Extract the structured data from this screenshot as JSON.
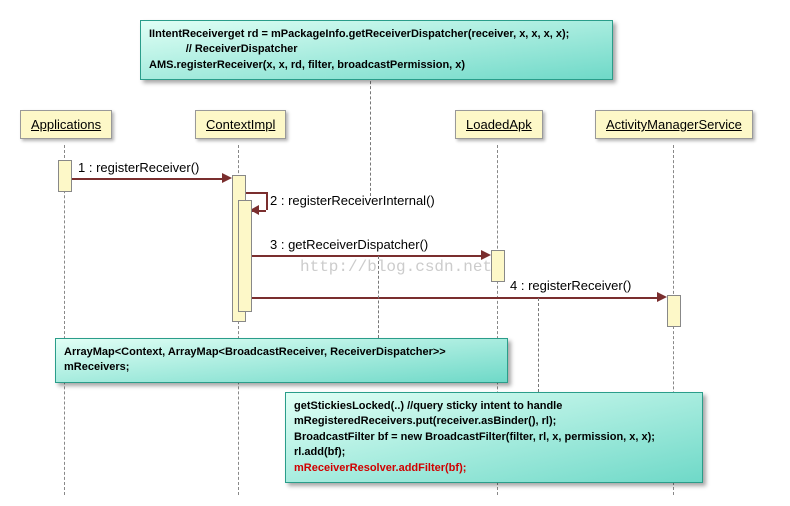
{
  "lifelines": {
    "l1": "Applications",
    "l2": "ContextImpl",
    "l3": "LoadedApk",
    "l4": "ActivityManagerService"
  },
  "messages": {
    "m1": "1 : registerReceiver()",
    "m2": "2 : registerReceiverInternal()",
    "m3": "3 : getReceiverDispatcher()",
    "m4": "4 : registerReceiver()"
  },
  "note_top": {
    "line1": "IIntentReceiverget rd = mPackageInfo.getReceiverDispatcher(receiver, x, x, x, x);",
    "line2": "// ReceiverDispatcher",
    "line3": "AMS.registerReceiver(x, x, rd, filter, broadcastPermission, x)"
  },
  "note_mid": "ArrayMap<Context, ArrayMap<BroadcastReceiver, ReceiverDispatcher>> mReceivers;",
  "note_bottom": {
    "line1": "getStickiesLocked(..) //query sticky intent to handle",
    "line2": "mRegisteredReceivers.put(receiver.asBinder(), rl);",
    "line3": "BroadcastFilter bf =  new BroadcastFilter(filter, rl, x, permission, x, x);",
    "line4": "rl.add(bf);",
    "line5": "mReceiverResolver.addFilter(bf);"
  },
  "watermark": "http://blog.csdn.net/"
}
